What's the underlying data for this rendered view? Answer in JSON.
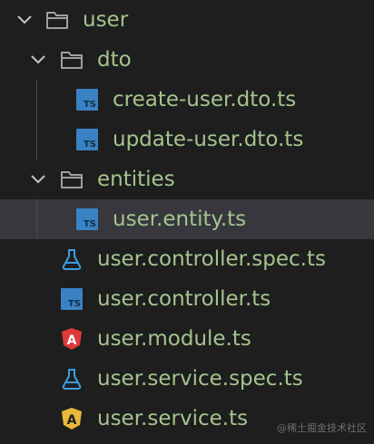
{
  "explorer": {
    "items": [
      {
        "label": "user",
        "icon": "folder-open-icon",
        "type": "folder",
        "expanded": true
      },
      {
        "label": "dto",
        "icon": "folder-open-icon",
        "type": "folder",
        "expanded": true
      },
      {
        "label": "create-user.dto.ts",
        "icon": "typescript-icon",
        "type": "file"
      },
      {
        "label": "update-user.dto.ts",
        "icon": "typescript-icon",
        "type": "file"
      },
      {
        "label": "entities",
        "icon": "folder-open-icon",
        "type": "folder",
        "expanded": true
      },
      {
        "label": "user.entity.ts",
        "icon": "typescript-icon",
        "type": "file",
        "selected": true
      },
      {
        "label": "user.controller.spec.ts",
        "icon": "test-flask-icon",
        "type": "file"
      },
      {
        "label": "user.controller.ts",
        "icon": "typescript-icon",
        "type": "file"
      },
      {
        "label": "user.module.ts",
        "icon": "angular-icon",
        "type": "file"
      },
      {
        "label": "user.service.spec.ts",
        "icon": "test-flask-icon",
        "type": "file"
      },
      {
        "label": "user.service.ts",
        "icon": "angular-icon",
        "type": "file"
      }
    ]
  },
  "ts_badge_text": "TS",
  "angular_glyph": "A",
  "watermark": "@稀土掘金技术社区",
  "colors": {
    "background": "#1e1e1e",
    "selected_row": "#37373d",
    "label_text": "#a4c48e",
    "folder_icon": "#9aa0a6",
    "ts_blue": "#3b82c4",
    "angular_red": "#dd3a3a",
    "angular_yellow": "#e8b83a",
    "flask_blue": "#3b9ee0"
  }
}
